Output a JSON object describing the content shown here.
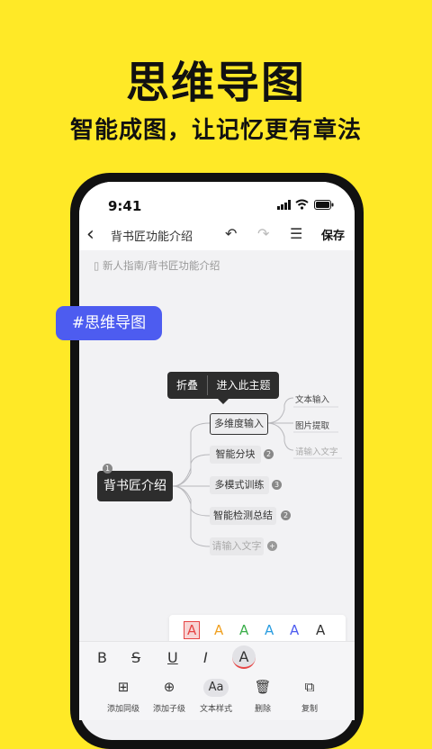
{
  "hero": {
    "title": "思维导图",
    "subtitle": "智能成图，让记忆更有章法"
  },
  "status_bar": {
    "time": "9:41"
  },
  "toolbar": {
    "back_icon": "‹",
    "doc_title": "背书匠功能介绍",
    "undo_icon": "↶",
    "redo_icon": "↷",
    "outline_icon": "☰",
    "save_label": "保存"
  },
  "breadcrumb": {
    "text": "新人指南/背书匠功能介绍"
  },
  "tag": {
    "label": "#思维导图"
  },
  "context_menu": {
    "fold": "折叠",
    "enter_topic": "进入此主题"
  },
  "mindmap": {
    "root": {
      "label": "背书匠介绍",
      "badge": "1"
    },
    "children": [
      {
        "label": "多维度输入",
        "selected": true
      },
      {
        "label": "智能分块",
        "badge": "2"
      },
      {
        "label": "多模式训练",
        "badge": "3"
      },
      {
        "label": "智能检测总结",
        "badge": "2"
      },
      {
        "label": "请输入文字",
        "placeholder": true
      }
    ],
    "grandchildren": [
      {
        "label": "文本输入"
      },
      {
        "label": "图片提取"
      },
      {
        "label": "请输入文字",
        "placeholder": true
      }
    ]
  },
  "palette": {
    "letter": "A",
    "colors": [
      "#E64545",
      "#F0A020",
      "#3BAE4A",
      "#2A9DE0",
      "#4D5CF0",
      "#333333"
    ]
  },
  "format_bar": {
    "bold": "B",
    "strike": "S",
    "underline": "U",
    "italic": "I",
    "color": "A"
  },
  "bottom_bar": [
    {
      "icon": "add-sibling-icon",
      "glyph": "⊞",
      "label": "添加同级"
    },
    {
      "icon": "add-child-icon",
      "glyph": "⊕",
      "label": "添加子级"
    },
    {
      "icon": "text-style-icon",
      "glyph": "Aa",
      "label": "文本样式"
    },
    {
      "icon": "trash-icon",
      "glyph": "🗑",
      "label": "删除"
    },
    {
      "icon": "copy-icon",
      "glyph": "⧉",
      "label": "复制"
    }
  ]
}
